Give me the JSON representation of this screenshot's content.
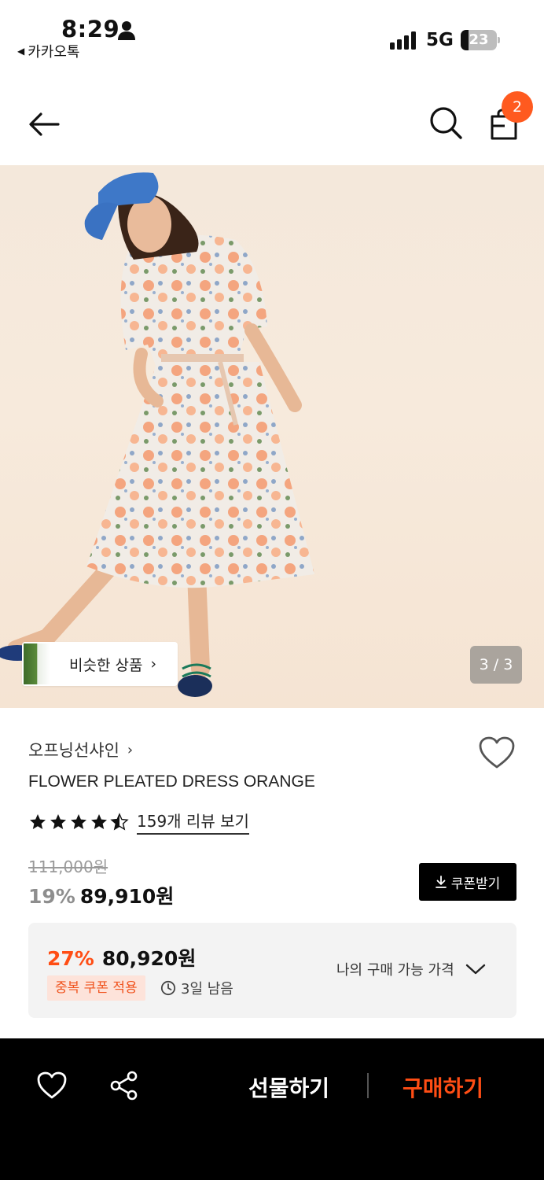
{
  "status_bar": {
    "time": "8:29",
    "back_app": "카카오톡",
    "network": "5G",
    "battery": "23"
  },
  "header": {
    "cart_count": "2",
    "icons": [
      "back-arrow-icon",
      "search-icon",
      "shopping-bag-icon"
    ]
  },
  "gallery": {
    "similar_label": "비슷한 상품",
    "similar_chevron": "›",
    "counter": "3 / 3"
  },
  "product": {
    "brand": "오프닝선샤인",
    "brand_chevron": "›",
    "name": "FLOWER PLEATED DRESS ORANGE",
    "rating": 4.5,
    "review_link": "159개 리뷰 보기",
    "original_price": "111,000원",
    "discount_rate": "19%",
    "sale_price": "89,910원",
    "coupon_label": "쿠폰받기"
  },
  "best_price": {
    "rate": "27%",
    "price": "80,920원",
    "badge": "중복 쿠폰 적용",
    "time_left": "3일 남음",
    "my_price_label": "나의 구매 가능 가격"
  },
  "bottom_bar": {
    "gift_label": "선물하기",
    "buy_label": "구매하기"
  },
  "colors": {
    "accent": "#ff4d14",
    "badge": "#ff5a1f",
    "black": "#000000"
  }
}
